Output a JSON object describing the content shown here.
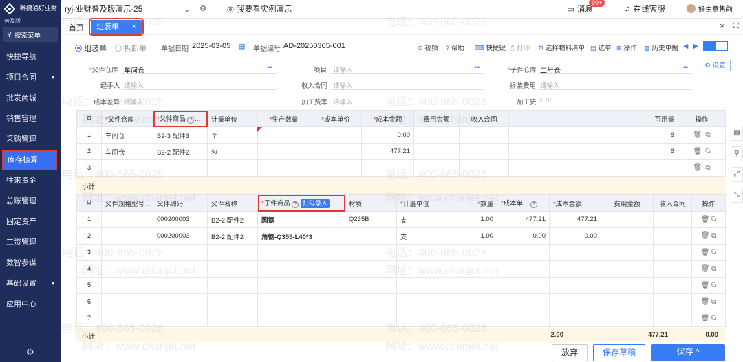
{
  "app": {
    "logo_line1": "畅捷通好业财",
    "logo_line2": "普及版",
    "account": "ryj-业财普及版演示-25",
    "demo_link": "我要看实例演示",
    "messages": "消息",
    "message_badge": "99+",
    "service": "在线客服",
    "user": "好生意售前"
  },
  "sidebar": {
    "search": "搜索菜单",
    "items": [
      {
        "label": "快捷导航",
        "arrow": ""
      },
      {
        "label": "项目合同",
        "arrow": "▼"
      },
      {
        "label": "批发商城",
        "arrow": ""
      },
      {
        "label": "销售管理",
        "arrow": ""
      },
      {
        "label": "采购管理",
        "arrow": ""
      },
      {
        "label": "库存核算",
        "arrow": ""
      },
      {
        "label": "往来资金",
        "arrow": ""
      },
      {
        "label": "总账管理",
        "arrow": ""
      },
      {
        "label": "固定资产",
        "arrow": ""
      },
      {
        "label": "工资管理",
        "arrow": ""
      },
      {
        "label": "数智参谋",
        "arrow": ""
      },
      {
        "label": "基础设置",
        "arrow": "▼"
      },
      {
        "label": "应用中心",
        "arrow": ""
      }
    ],
    "active_index": 5
  },
  "tabs": {
    "home": "首页",
    "active": "组装单"
  },
  "toolbar": {
    "assemble": "组装单",
    "disassemble": "拆卸单",
    "date_label": "单据日期",
    "date_value": "2025-03-05",
    "no_label": "单据编号",
    "no_value": "AD-20250305-001",
    "tools": [
      "视频",
      "帮助",
      "快捷键",
      "打印",
      "选择物料清单",
      "选单",
      "操作",
      "历史单据"
    ]
  },
  "form": {
    "parent_wh_label": "父件仓库",
    "parent_wh_value": "车间仓",
    "project_label": "项目",
    "project_ph": "请输入",
    "child_wh_label": "子件仓库",
    "child_wh_value": "二号仓",
    "settings": "设置",
    "handler_label": "经手人",
    "handler_ph": "请输入",
    "contract_label": "收入合同",
    "contract_ph": "请输入",
    "disassemble_fee_label": "拆装费用",
    "disassemble_fee_ph": "请输入",
    "cost_diff_label": "成本差异",
    "cost_diff_ph": "请输入",
    "rate_label": "加工费率",
    "rate_ph": "请输入",
    "fee_label": "加工费",
    "fee_value": "0.00"
  },
  "parent_table": {
    "headers": [
      "父件仓库",
      "父件商品",
      "计量单位",
      "生产数量",
      "成本单价",
      "成本金额",
      "费用金额",
      "收入合同",
      "可用量",
      "操作"
    ],
    "rows": [
      {
        "no": "1",
        "wh": "车间仓",
        "goods": "B2-3 配件3",
        "unit": "个",
        "qty": "",
        "price": "",
        "amount": "0.00",
        "fee": "",
        "contract": "",
        "avail": "8"
      },
      {
        "no": "2",
        "wh": "车间仓",
        "goods": "B2-2 配件2",
        "unit": "包",
        "qty": "",
        "price": "",
        "amount": "477.21",
        "fee": "",
        "contract": "",
        "avail": "6"
      },
      {
        "no": "3",
        "wh": "",
        "goods": "",
        "unit": "",
        "qty": "",
        "price": "",
        "amount": "",
        "fee": "",
        "contract": "",
        "avail": ""
      }
    ],
    "subtotal": "小计"
  },
  "child_table": {
    "headers": [
      "父件规格型号 ...",
      "父件编码",
      "父件名称",
      "子件商品",
      "扫码录入",
      "材质",
      "计量单位",
      "数量",
      "成本单...",
      "成本金额",
      "费用金额",
      "收入合同",
      "操作"
    ],
    "rows": [
      {
        "no": "1",
        "spec": "",
        "code": "000200003",
        "name": "B2-2 配件2",
        "goods": "圆钢",
        "material": "Q235B",
        "unit": "支",
        "qty": "1.00",
        "price": "477.21",
        "amount": "477.21",
        "fee": "",
        "contract": ""
      },
      {
        "no": "2",
        "spec": "",
        "code": "000200003",
        "name": "B2-2 配件2",
        "goods": "角钢-Q355-L40*3",
        "material": "",
        "unit": "支",
        "qty": "1.00",
        "price": "0.00",
        "amount": "0.00",
        "fee": "",
        "contract": ""
      },
      {
        "no": "3",
        "spec": "",
        "code": "",
        "name": "",
        "goods": "",
        "material": "",
        "unit": "",
        "qty": "",
        "price": "",
        "amount": "",
        "fee": "",
        "contract": ""
      },
      {
        "no": "4",
        "spec": "",
        "code": "",
        "name": "",
        "goods": "",
        "material": "",
        "unit": "",
        "qty": "",
        "price": "",
        "amount": "",
        "fee": "",
        "contract": ""
      },
      {
        "no": "5",
        "spec": "",
        "code": "",
        "name": "",
        "goods": "",
        "material": "",
        "unit": "",
        "qty": "",
        "price": "",
        "amount": "",
        "fee": "",
        "contract": ""
      },
      {
        "no": "6",
        "spec": "",
        "code": "",
        "name": "",
        "goods": "",
        "material": "",
        "unit": "",
        "qty": "",
        "price": "",
        "amount": "",
        "fee": "",
        "contract": ""
      },
      {
        "no": "7",
        "spec": "",
        "code": "",
        "name": "",
        "goods": "",
        "material": "",
        "unit": "",
        "qty": "",
        "price": "",
        "amount": "",
        "fee": "",
        "contract": ""
      }
    ],
    "subtotal": {
      "label": "小计",
      "qty": "2.00",
      "amount": "477.21",
      "fee": "0.00"
    }
  },
  "buttons": {
    "abandon": "放弃",
    "save_draft": "保存草稿",
    "save": "保存"
  },
  "watermark": {
    "phone": "电话：400-665-0028",
    "site": "网址：www.chanjet.net"
  },
  "colors": {
    "sidebar": "#1f2d5a",
    "accent": "#3a7cf5",
    "highlight": "#e03a2e"
  }
}
